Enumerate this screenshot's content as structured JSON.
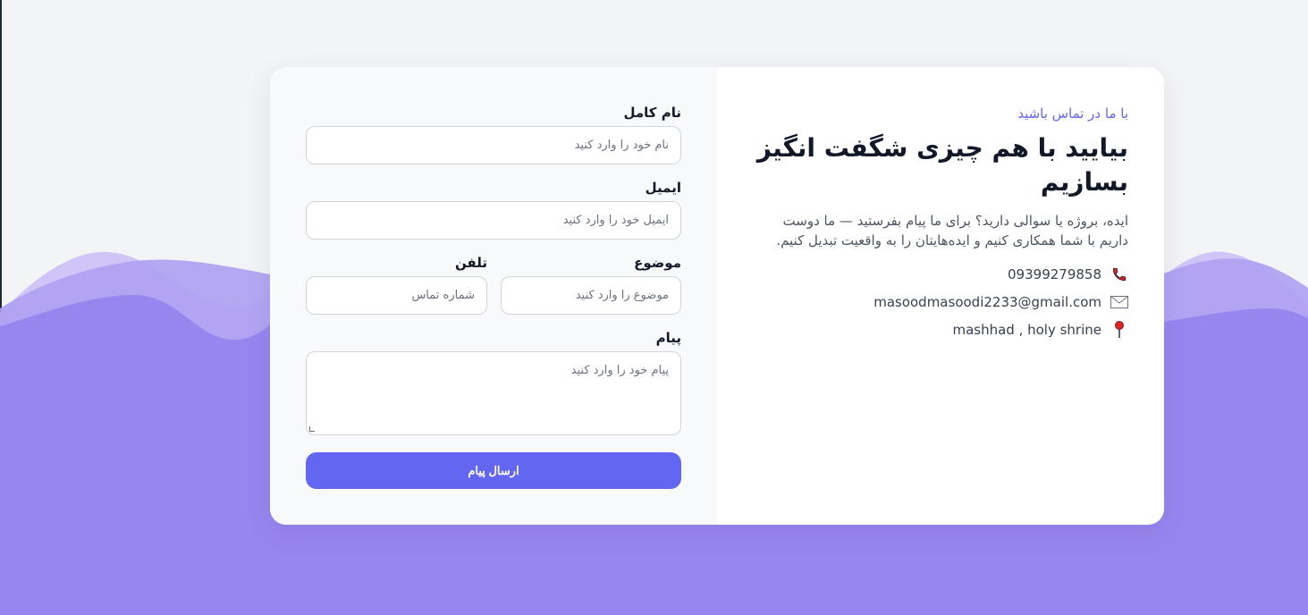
{
  "form": {
    "full_name": {
      "label": "نام کامل",
      "placeholder": "نام خود را وارد کنید"
    },
    "email": {
      "label": "ایمیل",
      "placeholder": "ایمیل خود را وارد کنید"
    },
    "subject": {
      "label": "موضوع",
      "placeholder": "موضوع را وارد کنید"
    },
    "phone": {
      "label": "تلفن",
      "placeholder": "شماره تماس"
    },
    "message": {
      "label": "پیام",
      "placeholder": "پیام خود را وارد کنید"
    },
    "submit_label": "ارسال پیام"
  },
  "info": {
    "eyebrow": "با ما در تماس باشید",
    "headline": "بیایید با هم چیزی شگفت انگیز بسازیم",
    "description": "ایده، بروژه یا سوالی دارید؟ برای ما پیام بفرستید — ما دوست داریم با شما همکاری کنیم و ایده‌هایتان را به واقعیت تبدیل کنیم.",
    "contacts": [
      {
        "icon": "phone-icon",
        "text": "09399279858"
      },
      {
        "icon": "envelope-icon",
        "text": "masoodmasoodi2233@gmail.com"
      },
      {
        "icon": "pin-icon",
        "text": "mashhad , holy shrine"
      }
    ]
  },
  "colors": {
    "accent": "#6366f1",
    "wave_base": "#9886ef",
    "wave_light": "#cbbdf6",
    "background": "#f3f4f6"
  }
}
